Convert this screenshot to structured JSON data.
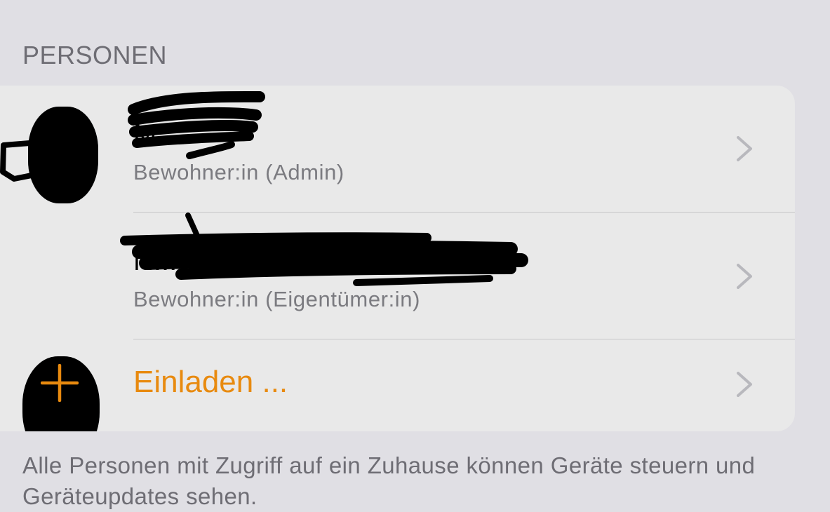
{
  "section": {
    "header": "PERSONEN"
  },
  "people": [
    {
      "name": "M...",
      "role": "Bewohner:in (Admin)",
      "avatar_icon": "avatar-redacted",
      "chevron_icon": "chevron-right-icon"
    },
    {
      "name": "N...",
      "role": "Bewohner:in (Eigentümer:in)",
      "avatar_icon": "avatar-redacted",
      "chevron_icon": "chevron-right-icon"
    }
  ],
  "invite": {
    "label": "Einladen ...",
    "icon": "plus-icon",
    "chevron_icon": "chevron-right-icon"
  },
  "footer": {
    "text": "Alle Personen mit Zugriff auf ein Zuhause können Geräte steuern und Geräteupdates sehen."
  },
  "colors": {
    "background": "#e0dfe4",
    "card": "#e9e9e9",
    "accent": "#e88a0f",
    "secondary_text": "#7b7b80",
    "chevron": "#b8b8bd",
    "redaction": "#000000"
  }
}
